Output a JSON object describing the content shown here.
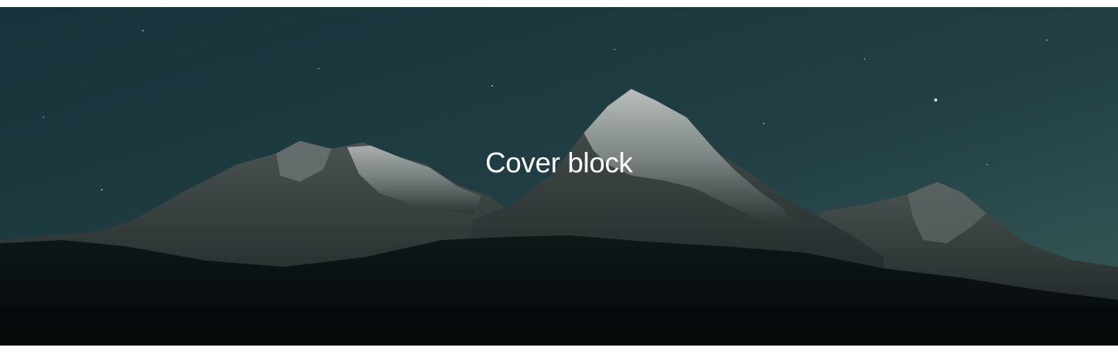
{
  "cover": {
    "title": "Cover block",
    "background_image": "mountain-night-photo"
  },
  "colors": {
    "sky_top": "#17343a",
    "sky_bottom": "#33504f",
    "foreground": "#0a1112",
    "title_text": "#ffffff"
  }
}
